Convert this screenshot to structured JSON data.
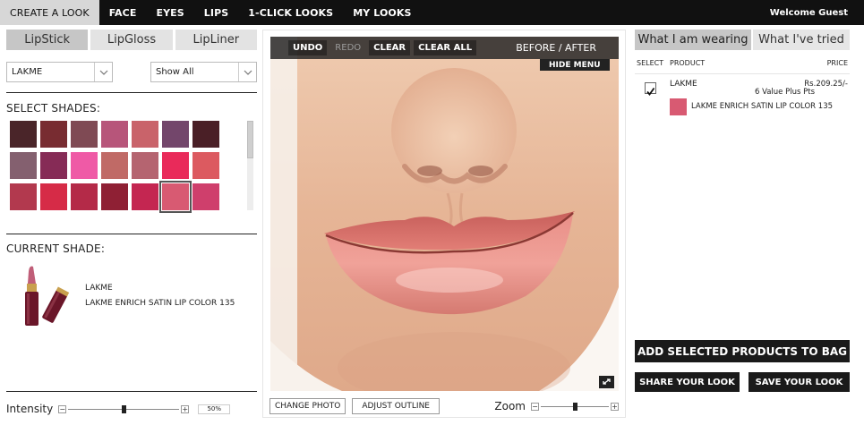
{
  "topnav": {
    "tabs": [
      {
        "label": "CREATE A LOOK",
        "active": true
      },
      {
        "label": "FACE",
        "active": false
      },
      {
        "label": "EYES",
        "active": false
      },
      {
        "label": "LIPS",
        "active": false
      },
      {
        "label": "1-CLICK LOOKS",
        "active": false
      },
      {
        "label": "MY LOOKS",
        "active": false
      }
    ],
    "welcome": "Welcome Guest"
  },
  "left": {
    "subtabs": [
      {
        "label": "LipStick",
        "active": true
      },
      {
        "label": "LipGloss",
        "active": false
      },
      {
        "label": "LipLiner",
        "active": false
      }
    ],
    "brand_select": "LAKME",
    "filter_select": "Show All",
    "select_shades_label": "SELECT SHADES:",
    "swatches": [
      "#4a2529",
      "#782c31",
      "#7f4a54",
      "#b7557a",
      "#c9636a",
      "#73466b",
      "#4a1f26",
      "#84606f",
      "#862b56",
      "#ef5aa6",
      "#c06a66",
      "#b56470",
      "#e92a5a",
      "#dc5a60",
      "#b2394e",
      "#d62b47",
      "#b42a48",
      "#8f2034",
      "#c42651",
      "#d85a72",
      "#cf3f6c"
    ],
    "selected_swatch": 19,
    "current_shade_label": "CURRENT SHADE:",
    "current_brand": "LAKME",
    "current_product": "LAKME ENRICH SATIN LIP COLOR 135",
    "intensity_label": "Intensity",
    "intensity_value": "50%",
    "intensity_level": 0.5
  },
  "center": {
    "toolbar": {
      "undo": "UNDO",
      "redo": "REDO",
      "clear": "CLEAR",
      "clear_all": "CLEAR ALL",
      "before_after": "BEFORE / AFTER"
    },
    "hide_menu": "HIDE MENU",
    "change_photo": "CHANGE PHOTO",
    "adjust_outline": "ADJUST OUTLINE",
    "zoom_label": "Zoom",
    "zoom_level": 0.5
  },
  "right": {
    "tabs": [
      {
        "label": "What I am wearing",
        "active": true
      },
      {
        "label": "What I've tried",
        "active": false
      }
    ],
    "columns": {
      "select": "SELECT",
      "product": "PRODUCT",
      "price": "PRICE"
    },
    "items": [
      {
        "checked": true,
        "brand": "LAKME",
        "price": "Rs.209.25/-",
        "points": "6 Value Plus Pts",
        "shade_color": "#d85a72",
        "name": "LAKME ENRICH SATIN LIP COLOR 135"
      }
    ],
    "add_to_bag": "ADD SELECTED PRODUCTS TO BAG",
    "share_look": "SHARE YOUR LOOK",
    "save_look": "SAVE YOUR LOOK"
  },
  "colors": {
    "nav_bg": "#111111",
    "active_tab": "#c6c6c6",
    "button_dark": "#1a1a1a"
  }
}
